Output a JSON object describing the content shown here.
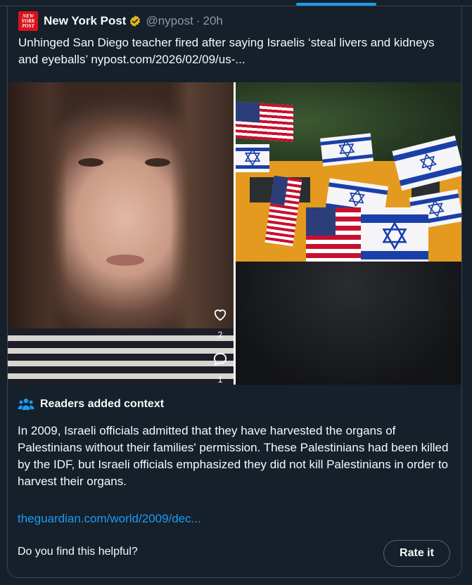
{
  "quoted_tweet": {
    "avatar_text": [
      "NEW",
      "YORK",
      "POST"
    ],
    "display_name": "New York Post",
    "verified_icon": "gold-verified-badge-icon",
    "handle": "@nypost",
    "separator": "·",
    "time": "20h",
    "text": "Unhinged San Diego teacher fired after saying Israelis ‘steal livers and kidneys and eyeballs’ nypost.com/2026/02/09/us-...",
    "media": {
      "left_overlay": {
        "like_icon": "heart-icon",
        "like_count": "2",
        "comment_icon": "comment-bubble-icon",
        "comment_count": "1"
      }
    }
  },
  "community_note": {
    "icon": "people-icon",
    "title": "Readers added context",
    "body": "In 2009, Israeli officials admitted that they have harvested the organs of Palestinians without their families' permission. These Palestinians had been killed by the IDF, but Israeli officials emphasized they did not kill Palestinians in order to harvest their organs.",
    "link": "theguardian.com/world/2009/dec...",
    "helpful_prompt": "Do you find this helpful?",
    "rate_button": "Rate it"
  },
  "colors": {
    "background": "#15202b",
    "border": "#38444d",
    "link": "#1d9bf0",
    "muted": "#8b98a5",
    "tab_indicator": "#1d9bf0"
  }
}
